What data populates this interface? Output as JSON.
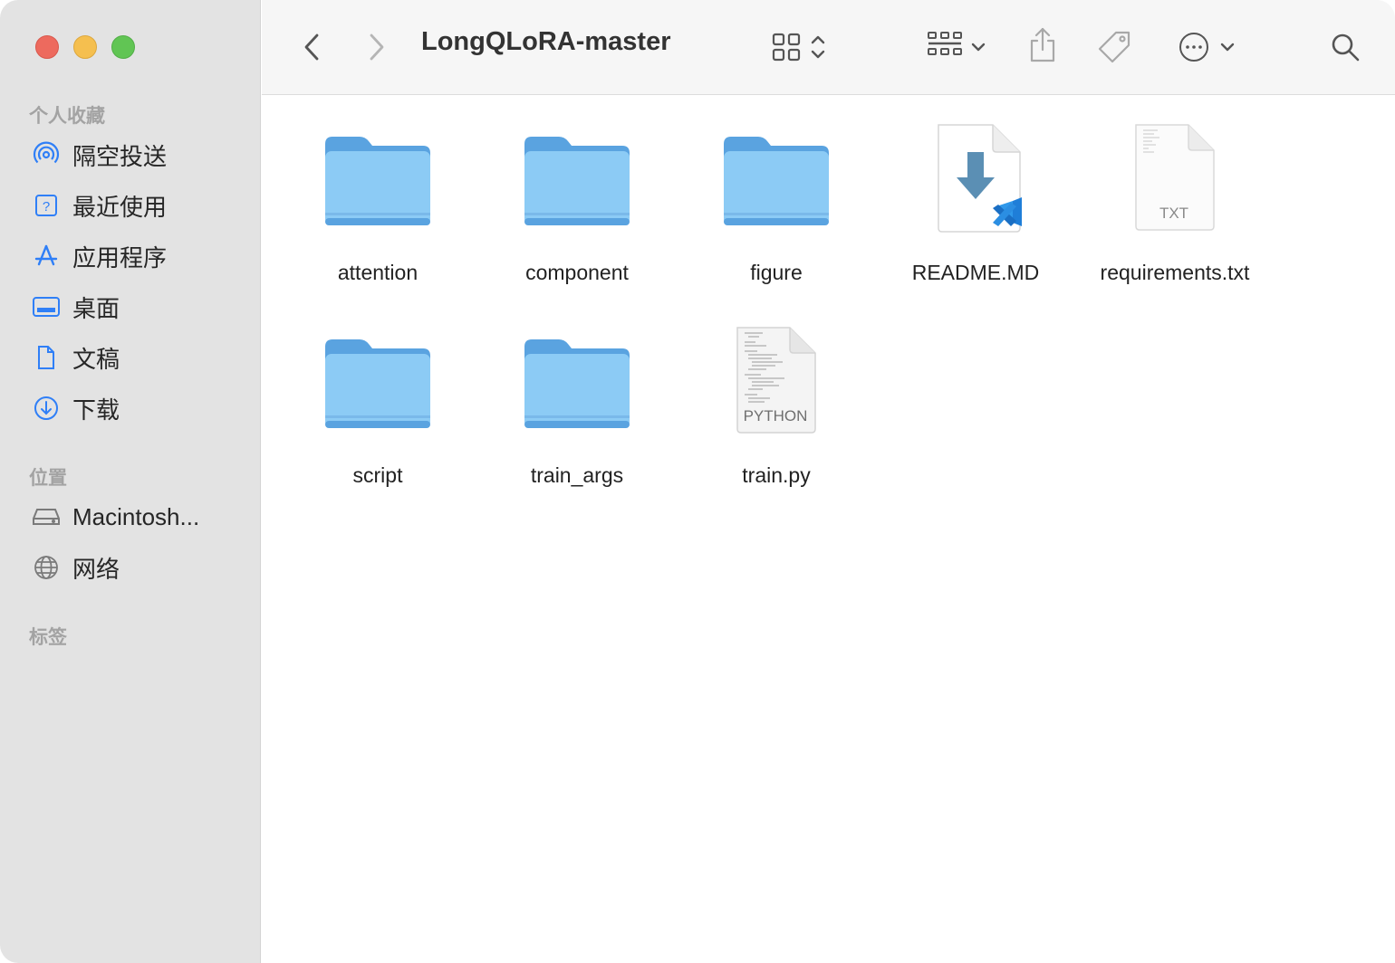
{
  "window": {
    "title": "LongQLoRA-master"
  },
  "sidebar": {
    "sections": [
      {
        "title": "个人收藏",
        "items": [
          {
            "label": "隔空投送",
            "icon": "airdrop-icon"
          },
          {
            "label": "最近使用",
            "icon": "recents-icon"
          },
          {
            "label": "应用程序",
            "icon": "applications-icon"
          },
          {
            "label": "桌面",
            "icon": "desktop-icon"
          },
          {
            "label": "文稿",
            "icon": "document-icon"
          },
          {
            "label": "下载",
            "icon": "download-icon"
          }
        ]
      },
      {
        "title": "位置",
        "items": [
          {
            "label": "Macintosh...",
            "icon": "drive-icon"
          },
          {
            "label": "网络",
            "icon": "network-icon"
          }
        ]
      },
      {
        "title": "标签",
        "items": []
      }
    ]
  },
  "toolbar": {
    "back": "chevron-left-icon",
    "forward": "chevron-right-icon",
    "view": "grid-view-icon",
    "group": "group-by-icon",
    "share": "share-icon",
    "tag": "tag-icon",
    "more": "more-icon",
    "search": "search-icon"
  },
  "files": [
    {
      "name": "attention",
      "kind": "folder"
    },
    {
      "name": "component",
      "kind": "folder"
    },
    {
      "name": "figure",
      "kind": "folder"
    },
    {
      "name": "README.MD",
      "kind": "vscode-doc"
    },
    {
      "name": "requirements.txt",
      "kind": "txt",
      "badge": "TXT"
    },
    {
      "name": "script",
      "kind": "folder"
    },
    {
      "name": "train_args",
      "kind": "folder"
    },
    {
      "name": "train.py",
      "kind": "python",
      "badge": "PYTHON"
    }
  ],
  "colors": {
    "folder": "#8ccbf5",
    "folder_tab": "#5aa3e0",
    "accent": "#2f7ff7",
    "sidebar_bg": "#e3e3e3"
  }
}
